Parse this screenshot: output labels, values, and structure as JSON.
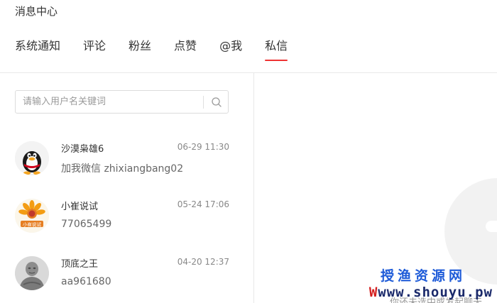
{
  "header": {
    "title": "消息中心"
  },
  "tabs": [
    {
      "label": "系统通知",
      "active": false
    },
    {
      "label": "评论",
      "active": false
    },
    {
      "label": "粉丝",
      "active": false
    },
    {
      "label": "点赞",
      "active": false
    },
    {
      "label": "@我",
      "active": false
    },
    {
      "label": "私信",
      "active": true
    }
  ],
  "search": {
    "placeholder": "请输入用户名关键词",
    "icon": "search-icon"
  },
  "conversations": [
    {
      "name": "沙漠枭雄6",
      "time": "06-29 11:30",
      "preview": "加我微信    zhixiangbang02",
      "avatar": "qq-penguin-avatar"
    },
    {
      "name": "小崔说试",
      "time": "05-24 17:06",
      "preview": "77065499",
      "avatar": "sunflower-logo-avatar",
      "avatar_text": "小崔说试"
    },
    {
      "name": "顶底之王",
      "time": "04-20 12:37",
      "preview": "aa961680",
      "avatar": "stone-figure-avatar"
    }
  ],
  "empty_state": {
    "hint": "你还未选中或发起聊天"
  },
  "watermark": {
    "cn": "授渔资源网",
    "url_prefix": "W",
    "url": "www.shouyu.pw"
  },
  "colors": {
    "accent": "#ee3333",
    "watermark_blue": "#1e5bd8",
    "watermark_navy": "#1b2a6b"
  }
}
